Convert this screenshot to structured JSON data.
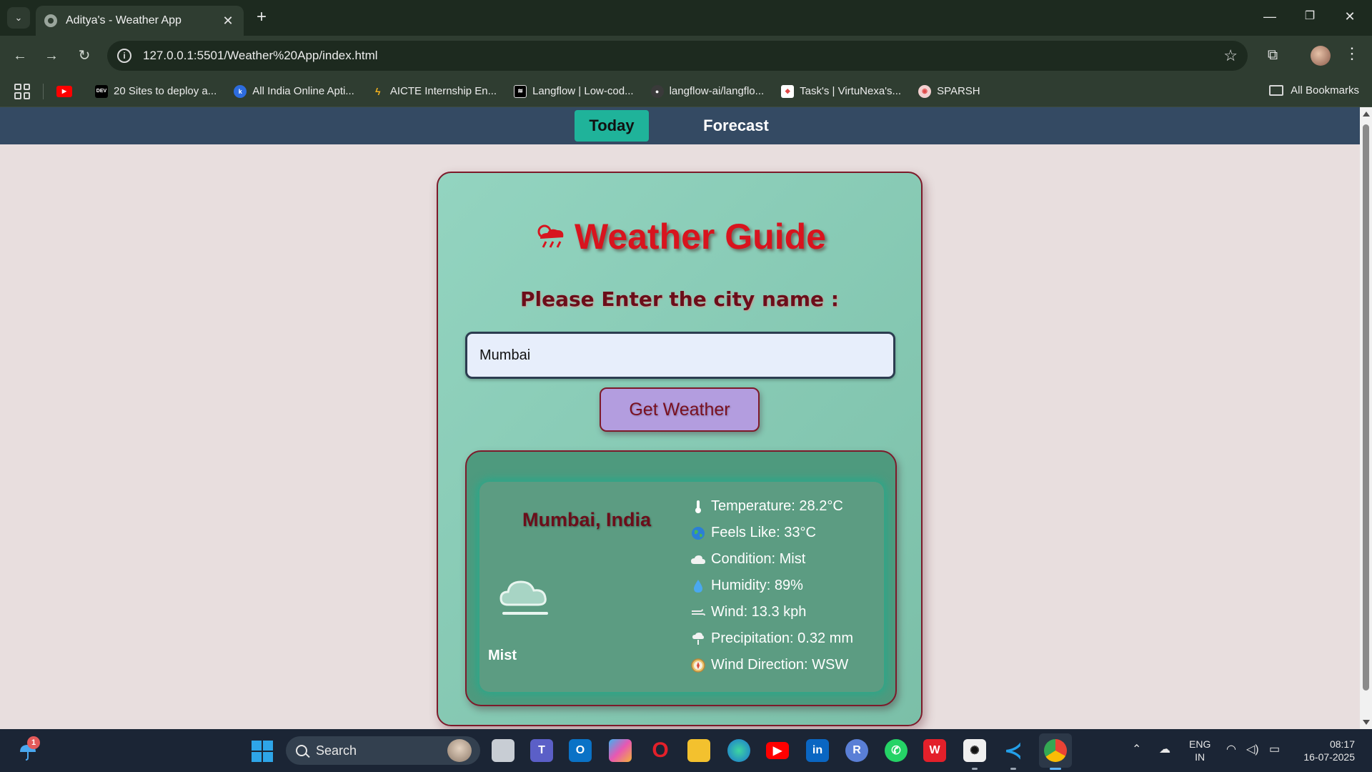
{
  "browser": {
    "tab_title": "Aditya's - Weather App",
    "url": "127.0.0.1:5501/Weather%20App/index.html",
    "bookmarks": [
      {
        "label": "",
        "icon": "youtube-icon",
        "color": "#ff0000"
      },
      {
        "label": "20 Sites to deploy a...",
        "icon": "dev-icon",
        "color": "#000000"
      },
      {
        "label": "All India Online Apti...",
        "icon": "k-icon",
        "color": "#2d6cdf"
      },
      {
        "label": "AICTE Internship En...",
        "icon": "aicte-icon",
        "color": "#f2b01e"
      },
      {
        "label": "Langflow | Low-cod...",
        "icon": "langflow-icon",
        "color": "#000000"
      },
      {
        "label": "langflow-ai/langflo...",
        "icon": "github-icon",
        "color": "#3a3a3a"
      },
      {
        "label": "Task's | VirtuNexa's...",
        "icon": "virtunexa-icon",
        "color": "#ffffff"
      },
      {
        "label": "SPARSH",
        "icon": "sparsh-icon",
        "color": "#e04848"
      }
    ],
    "all_bookmarks": "All Bookmarks"
  },
  "app": {
    "nav": {
      "today": "Today",
      "forecast": "Forecast"
    },
    "title": "Weather Guide",
    "prompt": "Please Enter the city name :",
    "city_input_value": "Mumbai",
    "button_label": "Get Weather",
    "result": {
      "location": "Mumbai, India",
      "condition_icon": "mist-cloud-icon",
      "condition_text": "Mist",
      "details": [
        {
          "icon": "thermometer-icon",
          "text": "Temperature: 28.2°C"
        },
        {
          "icon": "globe-icon",
          "text": "Feels Like: 33°C"
        },
        {
          "icon": "cloud-icon",
          "text": "Condition: Mist"
        },
        {
          "icon": "droplet-icon",
          "text": "Humidity: 89%"
        },
        {
          "icon": "wind-icon",
          "text": "Wind: 13.3 kph"
        },
        {
          "icon": "rain-cloud-icon",
          "text": "Precipitation: 0.32 mm"
        },
        {
          "icon": "compass-icon",
          "text": "Wind Direction: WSW"
        }
      ]
    },
    "colors": {
      "title": "#d8141e",
      "nav": "#344a63",
      "active_tab": "#1fb39a",
      "button": "#b39ddf"
    }
  },
  "taskbar": {
    "notification_count": "1",
    "search_label": "Search",
    "lang_line1": "ENG",
    "lang_line2": "IN",
    "time": "08:17",
    "date": "16-07-2025"
  }
}
